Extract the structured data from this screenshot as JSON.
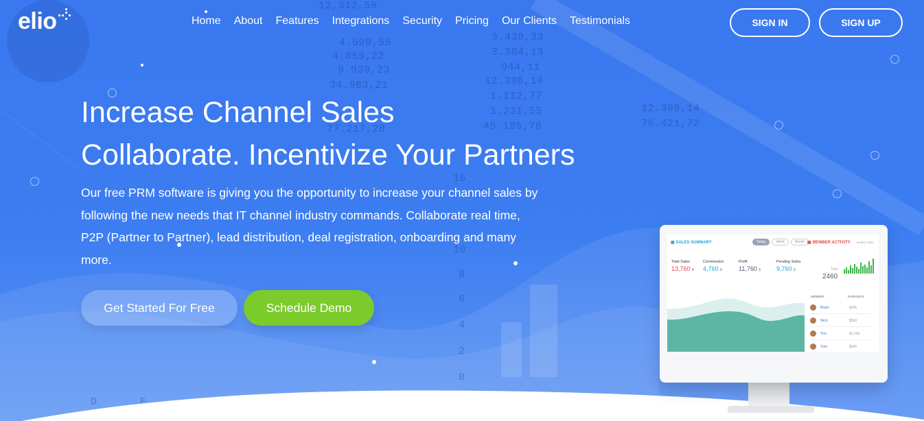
{
  "brand": {
    "logo": "elio"
  },
  "nav": {
    "items": [
      "Home",
      "About",
      "Features",
      "Integrations",
      "Security",
      "Pricing",
      "Our Clients",
      "Testimonials"
    ],
    "signin_label": "SIGN IN",
    "signup_label": "SIGN UP"
  },
  "hero": {
    "title_line1": "Increase Channel Sales",
    "title_line2": "Collaborate. Incentivize Your Partners",
    "description": "Our free PRM software is giving you the opportunity to increase your channel sales by following the new needs that IT channel industry commands. Collaborate real time, P2P (Partner to Partner), lead distribution, deal registration, onboarding and many more.",
    "cta_primary": "Get Started For Free",
    "cta_secondary": "Schedule Demo"
  },
  "colors": {
    "background": "#3c7df1",
    "cta_secondary": "#7ccb2c",
    "accent_blue": "#29a4d8",
    "accent_red": "#e04a4a"
  },
  "dashboard": {
    "sales_title": "SALES SUMMARY",
    "filters": [
      "Today",
      "Week",
      "Month"
    ],
    "member_title": "MEMBER ACTIVITY",
    "member_subtitle": "weekly stats",
    "stats": [
      {
        "label": "Total Sales",
        "value": "13,760",
        "unit": "$",
        "color": "#e04a4a"
      },
      {
        "label": "Commission",
        "value": "4,760",
        "unit": "$",
        "color": "#29a4d8"
      },
      {
        "label": "Profit",
        "value": "11,760",
        "unit": "$",
        "color": "#555577"
      },
      {
        "label": "Pending Sales",
        "value": "9,760",
        "unit": "$",
        "color": "#29a4d8"
      }
    ],
    "total_label": "Total",
    "total_value": "2460",
    "member_head": "MEMBER",
    "earnings_head": "EARNINGS",
    "members": [
      {
        "name": "Brain",
        "earnings": "$345"
      },
      {
        "name": "Nick",
        "earnings": "$560"
      },
      {
        "name": "Tim",
        "earnings": "$1,145"
      },
      {
        "name": "Tom",
        "earnings": "$645"
      }
    ]
  }
}
